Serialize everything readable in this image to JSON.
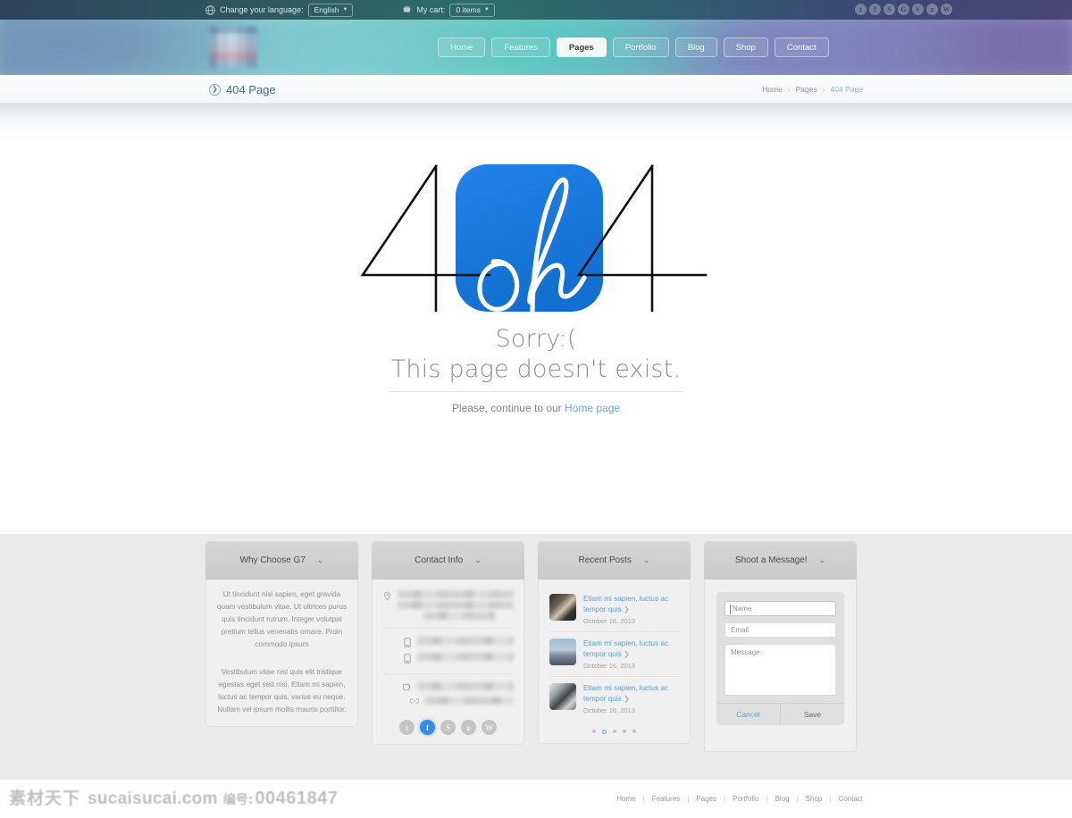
{
  "topbar": {
    "globe_icon": "globe-icon",
    "language_label": "Change your language:",
    "language_value": "English",
    "cart_icon": "cart-icon",
    "cart_label": "My cart:",
    "cart_value": "0 items",
    "social": [
      {
        "name": "twitter-icon",
        "glyph": "t"
      },
      {
        "name": "facebook-icon",
        "glyph": "f"
      },
      {
        "name": "skype-icon",
        "glyph": "S"
      },
      {
        "name": "google-plus-icon",
        "glyph": "G"
      },
      {
        "name": "vimeo-icon",
        "glyph": "V"
      },
      {
        "name": "rss-icon",
        "glyph": "ʑ"
      },
      {
        "name": "wordpress-icon",
        "glyph": "W"
      }
    ]
  },
  "header": {
    "logo_alt": "site-logo",
    "nav": [
      {
        "label": "Home",
        "active": false
      },
      {
        "label": "Features",
        "active": false
      },
      {
        "label": "Pages",
        "active": true
      },
      {
        "label": "Portfolio",
        "active": false
      },
      {
        "label": "Blog",
        "active": false
      },
      {
        "label": "Shop",
        "active": false
      },
      {
        "label": "Contact",
        "active": false
      }
    ]
  },
  "breadcrumb_bar": {
    "page_title": "404 Page",
    "items": [
      "Home",
      "Pages",
      "404 Page"
    ],
    "separator": "›"
  },
  "error_page": {
    "graphic": {
      "left_digit": "4",
      "right_digit": "4",
      "script_text": "oh",
      "tile_color": "#1678de"
    },
    "line1": "Sorry:(",
    "line2": "This page doesn't exist.",
    "continue_prefix": "Please, continue to our ",
    "continue_link": "Home page"
  },
  "widgets": [
    {
      "title": "Why Choose G7",
      "chevron": "chevron-down-icon",
      "paragraphs": [
        "Ut tincidunt nisl sapien, eget gravida quam vestibulum vitae. Ut ultrices purus quis tincidunt rutrum. Integer volutpat pretium tellus venenatis ornare. Proin commodo ipsum",
        "Vestibulum vitae nisl quis elit tristique egestas eget sed nisi. Etiam mi sapien, luctus ac tempor quis, varius eu neque. Nullam vel ipsum mollis mauris porttitor."
      ]
    },
    {
      "title": "Contact Info",
      "chevron": "chevron-down-icon",
      "rows": [
        {
          "icon": "location-pin-icon",
          "value": "",
          "redacted": true,
          "lines": 3
        },
        {
          "icon": "phone-icon",
          "value": "",
          "redacted": true,
          "lines": 1
        },
        {
          "icon": "phone-icon",
          "value": "",
          "redacted": true,
          "lines": 1
        },
        {
          "icon": "email-icon",
          "value": "",
          "redacted": true,
          "lines": 1
        },
        {
          "icon": "link-icon",
          "value": "",
          "redacted": true,
          "lines": 1
        }
      ],
      "social": [
        {
          "name": "twitter-icon",
          "glyph": "t",
          "active": false
        },
        {
          "name": "facebook-icon",
          "glyph": "f",
          "active": true
        },
        {
          "name": "skype-icon",
          "glyph": "S",
          "active": false
        },
        {
          "name": "rss-icon",
          "glyph": "ʑ",
          "active": false
        },
        {
          "name": "wordpress-icon",
          "glyph": "W",
          "active": false
        }
      ]
    },
    {
      "title": "Recent Posts",
      "chevron": "chevron-down-icon",
      "posts": [
        {
          "title": "Etiam mi sapien, luctus ac tempor quis",
          "date": "October 16, 2013",
          "thumb": "post-thumbnail"
        },
        {
          "title": "Etiam mi sapien, luctus ac tempor quis",
          "date": "October 16, 2013",
          "thumb": "post-thumbnail"
        },
        {
          "title": "Etiam mi sapien, luctus ac tempor quis",
          "date": "October 16, 2013",
          "thumb": "post-thumbnail"
        }
      ],
      "dots": 5,
      "active_dot": 1
    },
    {
      "title": "Shoot a Message!",
      "chevron": "chevron-down-icon",
      "form": {
        "name_placeholder": "Name",
        "name_value": "",
        "email_placeholder": "Email",
        "email_value": "",
        "message_placeholder": "Message",
        "message_value": "",
        "cancel_label": "Cancel",
        "save_label": "Save"
      }
    }
  ],
  "footer": {
    "nav": [
      "Home",
      "Features",
      "Pages",
      "Portfolio",
      "Blog",
      "Shop",
      "Contact"
    ],
    "separator": "|"
  },
  "watermark": {
    "cn": "素材天下",
    "domain": "sucaisucai.com",
    "no_label": "编号:",
    "number": "00461847"
  },
  "colors": {
    "accent_blue": "#1678de",
    "link_blue": "#5a9fd6",
    "footer_bg": "#eaeaea",
    "widget_head": "#d0d0d0"
  }
}
